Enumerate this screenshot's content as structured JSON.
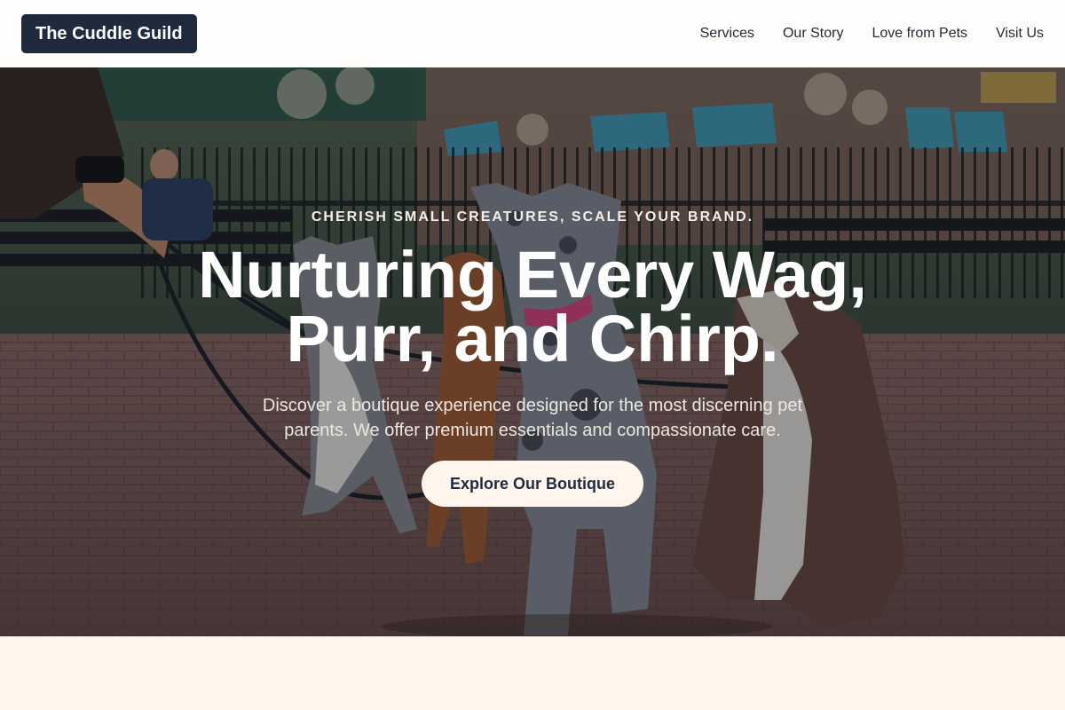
{
  "header": {
    "logo": "The Cuddle Guild",
    "nav": [
      "Services",
      "Our Story",
      "Love from Pets",
      "Visit Us"
    ]
  },
  "hero": {
    "eyebrow": "CHERISH SMALL CREATURES, SCALE YOUR BRAND.",
    "headline_line1": "Nurturing Every Wag,",
    "headline_line2": "Purr, and Chirp.",
    "subtext": "Discover a boutique experience designed for the most discerning pet parents. We offer premium essentials and compassionate care.",
    "cta_label": "Explore Our Boutique",
    "image_description": "photo-of-dogs-on-leashes-in-city-park"
  },
  "colors": {
    "logo_bg": "#1f2a3d",
    "page_bg": "#fff5ec",
    "cta_bg": "#fff5ec",
    "cta_text": "#1f2a3d"
  }
}
